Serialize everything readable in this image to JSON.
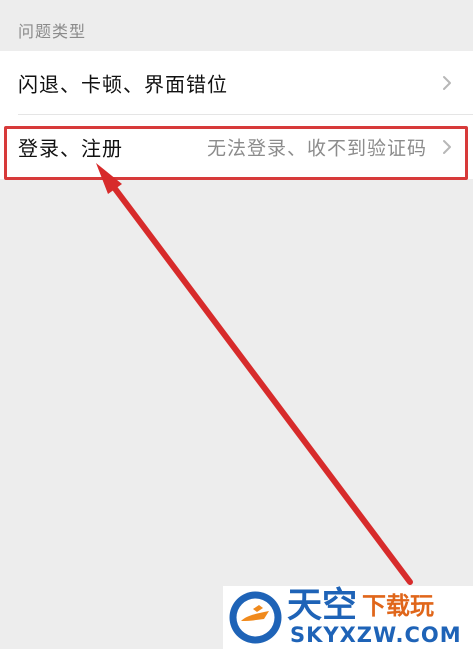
{
  "section": {
    "title": "问题类型"
  },
  "items": [
    {
      "label": "闪退、卡顿、界面错位",
      "value": ""
    },
    {
      "label": "登录、注册",
      "value": "无法登录、收不到验证码"
    }
  ],
  "watermark": {
    "main": "天空",
    "sub": "下载玩",
    "domain": "SKYXZW.COM"
  },
  "colors": {
    "background": "#ededed",
    "highlight": "#d73a3a",
    "arrow": "#d72b2b",
    "chevron": "#b7b7b7"
  }
}
